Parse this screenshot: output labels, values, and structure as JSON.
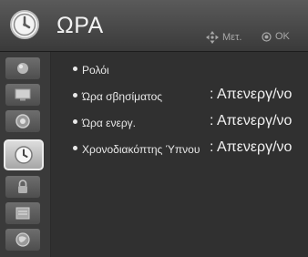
{
  "header": {
    "title": "ΩΡΑ",
    "hint_move": "Μετ.",
    "hint_ok": "OK",
    "icon": "clock-icon"
  },
  "sidebar": {
    "items": [
      {
        "icon": "picture-icon"
      },
      {
        "icon": "screen-icon"
      },
      {
        "icon": "speaker-icon"
      },
      {
        "icon": "clock-icon",
        "selected": true
      },
      {
        "icon": "lock-icon"
      },
      {
        "icon": "options-icon"
      },
      {
        "icon": "globe-icon"
      }
    ]
  },
  "menu": {
    "items": [
      {
        "label": "Ρολόι",
        "value": ""
      },
      {
        "label": "Ώρα σβησίματος",
        "value": ": Απενεργ/νο"
      },
      {
        "label": "Ώρα ενεργ.",
        "value": ": Απενεργ/νο"
      },
      {
        "label": "Χρονοδιακόπτης Ύπνου",
        "value": ": Απενεργ/νο"
      }
    ]
  },
  "colors": {
    "background": "#2a2a2a",
    "header": "#4a4a4a",
    "text": "#ececec",
    "selected": "#d0d0d0"
  }
}
